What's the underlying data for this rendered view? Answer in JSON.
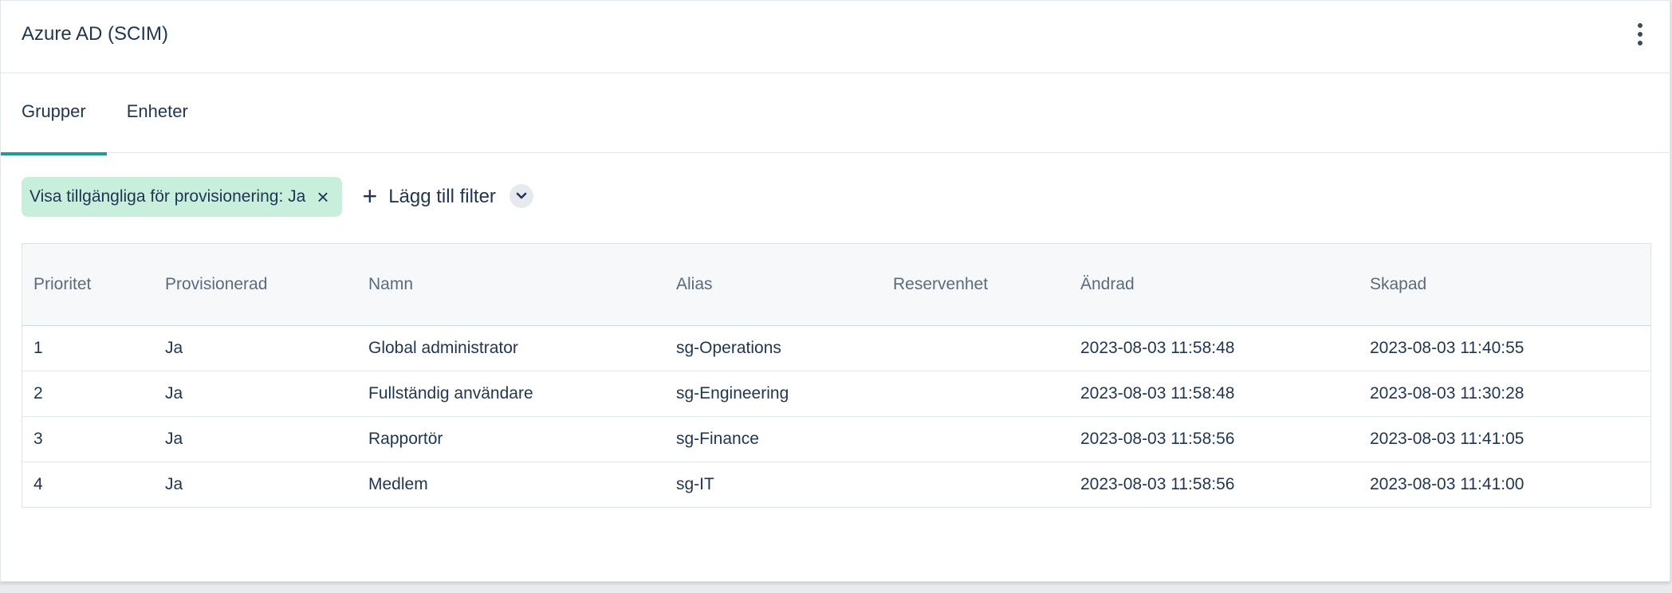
{
  "header": {
    "title": "Azure AD (SCIM)"
  },
  "tabs": [
    {
      "label": "Grupper",
      "active": true
    },
    {
      "label": "Enheter",
      "active": false
    }
  ],
  "filter": {
    "chip_label": "Visa tillgängliga för provisionering: Ja",
    "add_filter_label": "Lägg till filter"
  },
  "table": {
    "columns": [
      "Prioritet",
      "Provisionerad",
      "Namn",
      "Alias",
      "Reservenhet",
      "Ändrad",
      "Skapad"
    ],
    "rows": [
      [
        "1",
        "Ja",
        "Global administrator",
        "sg-Operations",
        "",
        "2023-08-03 11:58:48",
        "2023-08-03 11:40:55"
      ],
      [
        "2",
        "Ja",
        "Fullständig användare",
        "sg-Engineering",
        "",
        "2023-08-03 11:58:48",
        "2023-08-03 11:30:28"
      ],
      [
        "3",
        "Ja",
        "Rapportör",
        "sg-Finance",
        "",
        "2023-08-03 11:58:56",
        "2023-08-03 11:41:05"
      ],
      [
        "4",
        "Ja",
        "Medlem",
        "sg-IT",
        "",
        "2023-08-03 11:58:56",
        "2023-08-03 11:41:00"
      ]
    ]
  },
  "colors": {
    "accent": "#1a9e9a",
    "chip_bg": "#c7efdc",
    "text": "#1f3550"
  },
  "icons": {
    "menu": "kebab-menu-icon",
    "chip_close": "close-icon",
    "add": "plus-icon",
    "expand": "chevron-down-icon"
  }
}
